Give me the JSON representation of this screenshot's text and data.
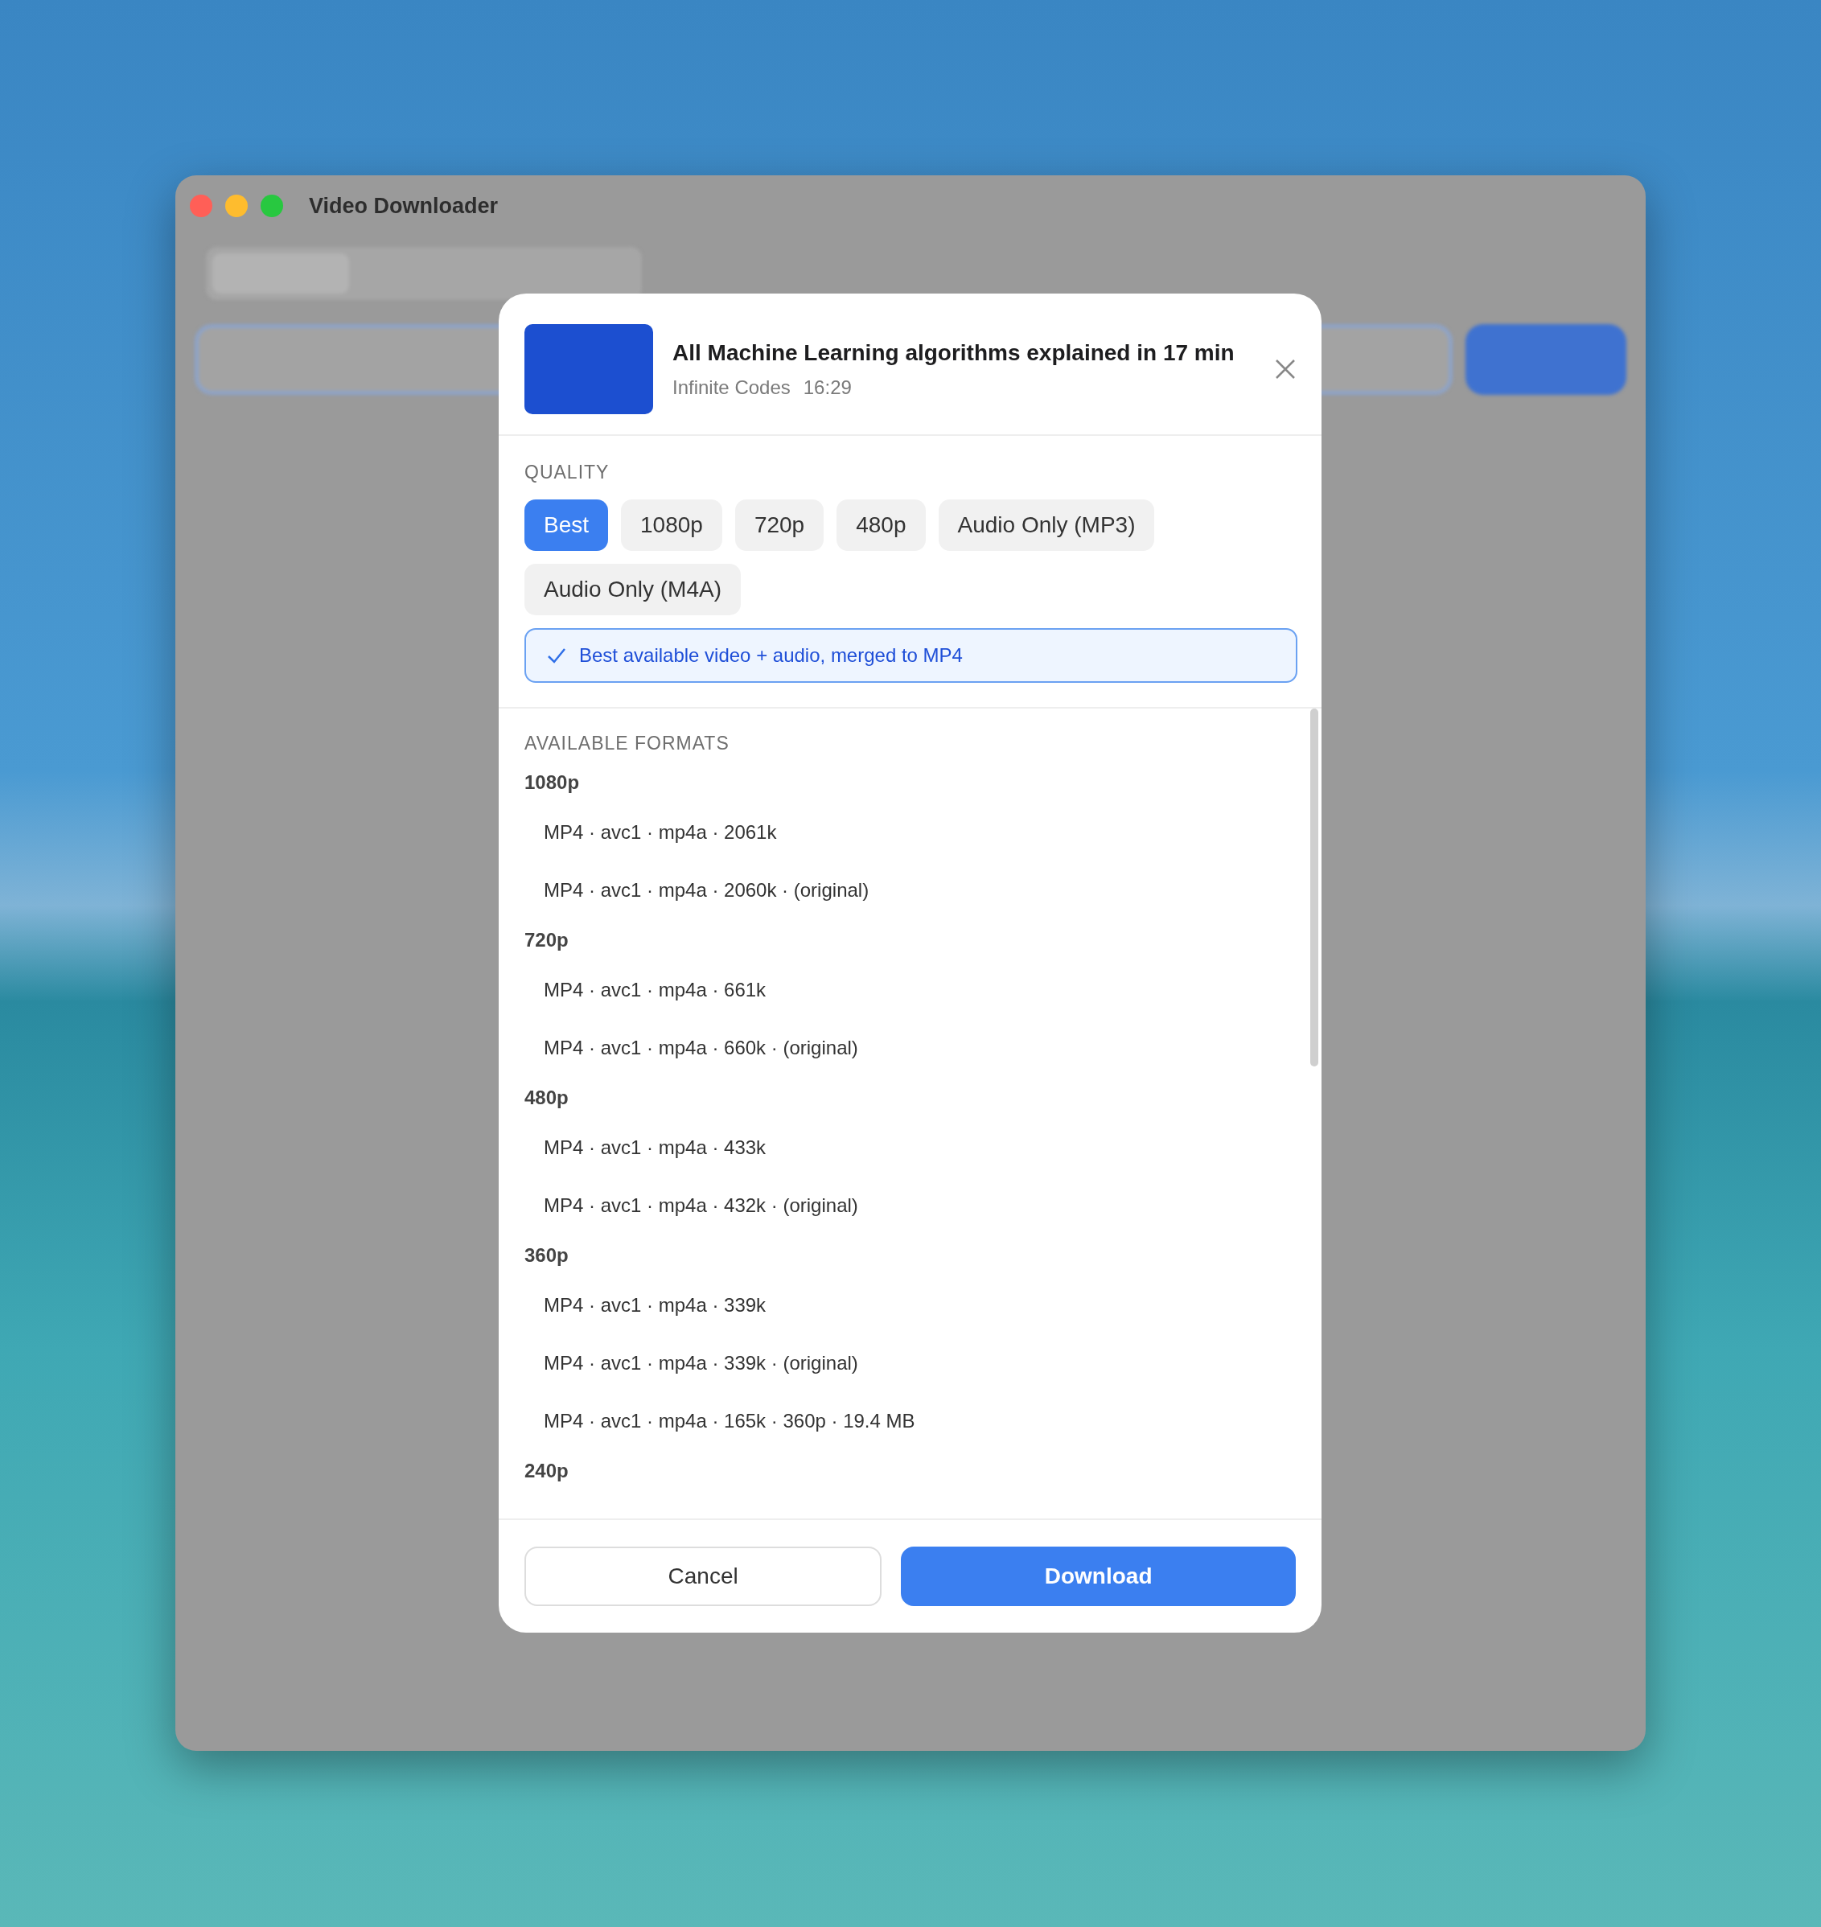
{
  "window": {
    "title": "Video Downloader"
  },
  "dialog": {
    "video": {
      "title": "All Machine Learning algorithms explained in 17 min",
      "channel": "Infinite Codes",
      "duration": "16:29"
    },
    "quality": {
      "label": "QUALITY",
      "options": [
        {
          "label": "Best",
          "selected": true
        },
        {
          "label": "1080p",
          "selected": false
        },
        {
          "label": "720p",
          "selected": false
        },
        {
          "label": "480p",
          "selected": false
        },
        {
          "label": "Audio Only (MP3)",
          "selected": false
        },
        {
          "label": "Audio Only (M4A)",
          "selected": false
        }
      ],
      "info": "Best available video + audio, merged to MP4"
    },
    "formats": {
      "label": "AVAILABLE FORMATS",
      "groups": [
        {
          "label": "1080p",
          "items": [
            "MP4 · avc1 · mp4a · 2061k",
            "MP4 · avc1 · mp4a · 2060k · (original)"
          ]
        },
        {
          "label": "720p",
          "items": [
            "MP4 · avc1 · mp4a · 661k",
            "MP4 · avc1 · mp4a · 660k · (original)"
          ]
        },
        {
          "label": "480p",
          "items": [
            "MP4 · avc1 · mp4a · 433k",
            "MP4 · avc1 · mp4a · 432k · (original)"
          ]
        },
        {
          "label": "360p",
          "items": [
            "MP4 · avc1 · mp4a · 339k",
            "MP4 · avc1 · mp4a · 339k · (original)",
            "MP4 · avc1 · mp4a · 165k · 360p · 19.4 MB"
          ]
        },
        {
          "label": "240p"
        }
      ]
    },
    "buttons": [
      {
        "label": "Cancel",
        "kind": "secondary"
      },
      {
        "label": "Download",
        "kind": "primary"
      }
    ]
  }
}
